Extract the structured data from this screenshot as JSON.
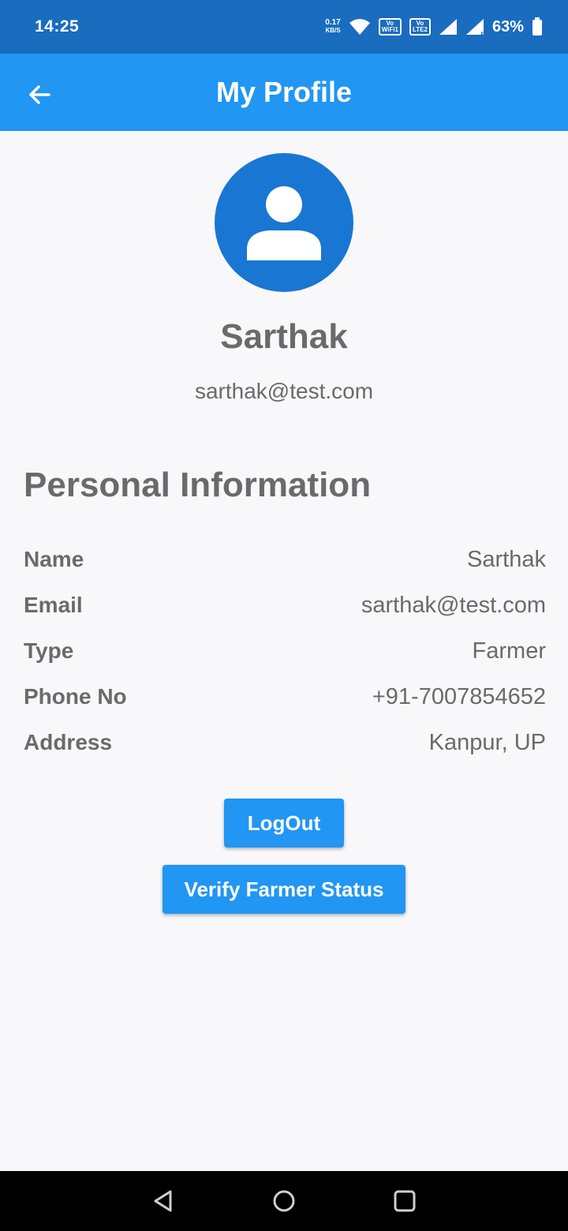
{
  "status_bar": {
    "time": "14:25",
    "net_speed_value": "0.17",
    "net_speed_unit": "KB/S",
    "volte_wifi_top": "Vo",
    "volte_wifi_bottom": "WiFi1",
    "volte_lte_top": "Vo",
    "volte_lte_bottom": "LTE2",
    "roaming_marker": "R",
    "battery": "63%"
  },
  "app_bar": {
    "title": "My Profile"
  },
  "profile": {
    "name": "Sarthak",
    "email": "sarthak@test.com"
  },
  "personal_info": {
    "title": "Personal Information",
    "rows": [
      {
        "label": "Name",
        "value": "Sarthak"
      },
      {
        "label": "Email",
        "value": "sarthak@test.com"
      },
      {
        "label": "Type",
        "value": "Farmer"
      },
      {
        "label": "Phone No",
        "value": "+91-7007854652"
      },
      {
        "label": "Address",
        "value": "Kanpur, UP"
      }
    ]
  },
  "actions": {
    "logout_label": "LogOut",
    "verify_label": "Verify Farmer Status"
  },
  "colors": {
    "status_bar": "#1a6cbf",
    "app_bar": "#2196f3",
    "avatar": "#1976d2",
    "text": "#6a6a6a",
    "background": "#f8f8fb"
  },
  "icons": {
    "back": "arrow-left-icon",
    "avatar": "person-icon",
    "wifi": "wifi-icon",
    "signal": "signal-icon",
    "battery": "battery-icon",
    "nav_back": "triangle-back-icon",
    "nav_home": "circle-home-icon",
    "nav_recents": "square-recents-icon"
  }
}
